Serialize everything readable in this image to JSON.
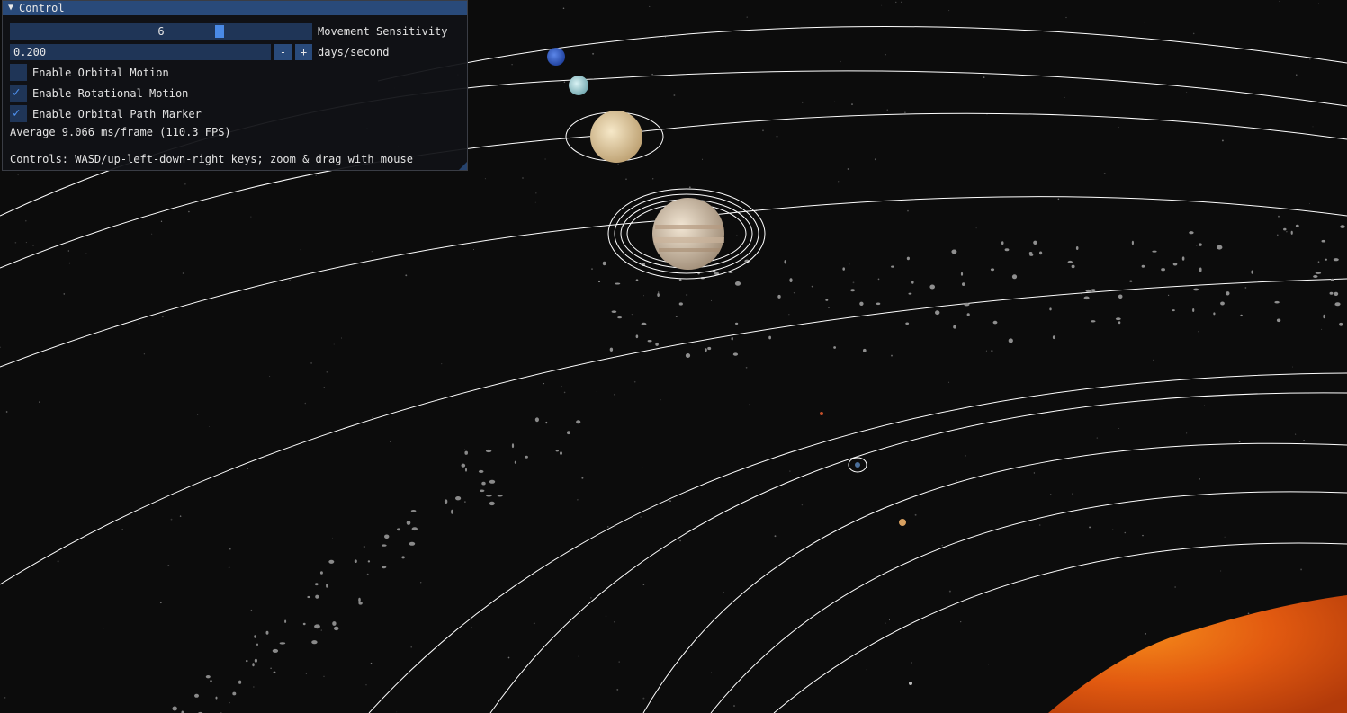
{
  "window": {
    "title": "Control",
    "movement_sensitivity": {
      "value": "6",
      "label": "Movement Sensitivity",
      "fraction": 0.7
    },
    "time_speed": {
      "value": "0.200",
      "minus_label": "-",
      "plus_label": "+",
      "unit_label": "days/second"
    },
    "checkboxes": [
      {
        "label": "Enable Orbital Motion",
        "checked": false
      },
      {
        "label": "Enable Rotational Motion",
        "checked": true
      },
      {
        "label": "Enable Orbital Path Marker",
        "checked": true
      }
    ],
    "fps_text": "Average 9.066 ms/frame (110.3 FPS)",
    "controls_text": "Controls: WASD/up-left-down-right keys; zoom & drag with mouse"
  },
  "icons": {
    "collapse": "triangle-down-icon",
    "check": "checkmark-icon"
  },
  "colors": {
    "title_bar": "#294a7a",
    "frame_bg": "#1f3557",
    "accent": "#4a8ae6",
    "space_bg": "#0b0b0b",
    "orbit_line": "#ffffff",
    "sun": "#e0520f"
  }
}
